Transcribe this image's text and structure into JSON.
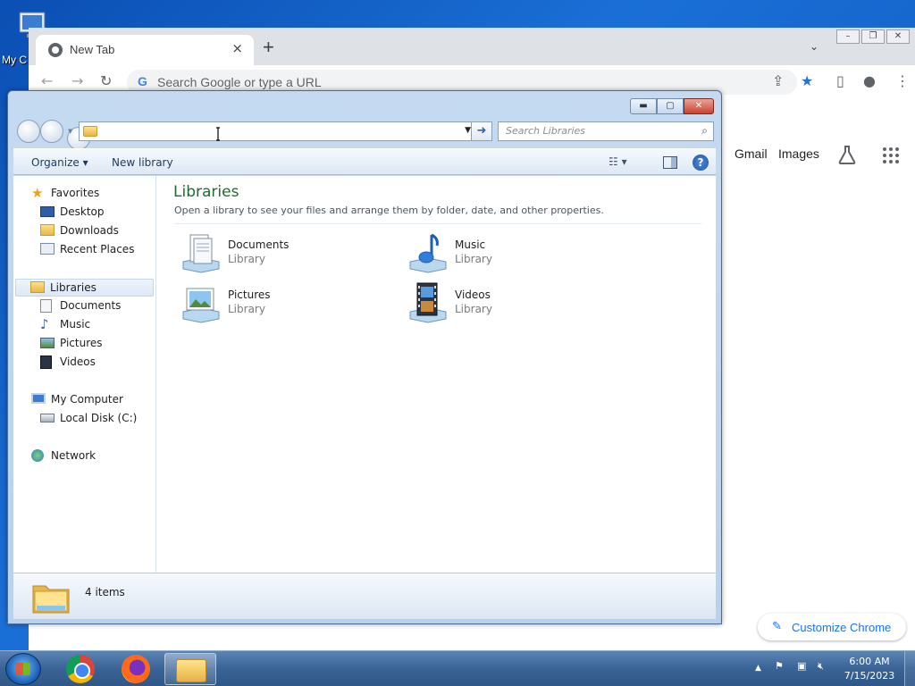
{
  "desktop": {
    "computer_icon_label": "My C"
  },
  "chrome": {
    "tab_title": "New Tab",
    "tab_close": "×",
    "new_tab": "+",
    "tab_menu": "⌄",
    "omnibox_placeholder": "Search Google or type a URL",
    "links": [
      "Gmail",
      "Images"
    ],
    "customize_label": "Customize Chrome"
  },
  "explorer": {
    "address_value": "",
    "search_placeholder": "Search Libraries",
    "commands": {
      "organize": "Organize ▾",
      "new_library": "New library"
    },
    "nav": {
      "favorites": {
        "label": "Favorites",
        "items": [
          "Desktop",
          "Downloads",
          "Recent Places"
        ]
      },
      "libraries": {
        "label": "Libraries",
        "items": [
          "Documents",
          "Music",
          "Pictures",
          "Videos"
        ]
      },
      "computer": {
        "label": "My Computer",
        "items": [
          "Local Disk (C:)"
        ]
      },
      "network": {
        "label": "Network"
      }
    },
    "content": {
      "heading": "Libraries",
      "subtitle": "Open a library to see your files and arrange them by folder, date, and other properties.",
      "libraries": [
        {
          "name": "Documents",
          "type": "Library",
          "icon": "documents-library-icon"
        },
        {
          "name": "Music",
          "type": "Library",
          "icon": "music-library-icon"
        },
        {
          "name": "Pictures",
          "type": "Library",
          "icon": "pictures-library-icon"
        },
        {
          "name": "Videos",
          "type": "Library",
          "icon": "videos-library-icon"
        }
      ]
    },
    "details": {
      "item_count": "4 items"
    }
  },
  "taskbar": {
    "clock_time": "6:00 AM",
    "clock_date": "7/15/2023"
  }
}
